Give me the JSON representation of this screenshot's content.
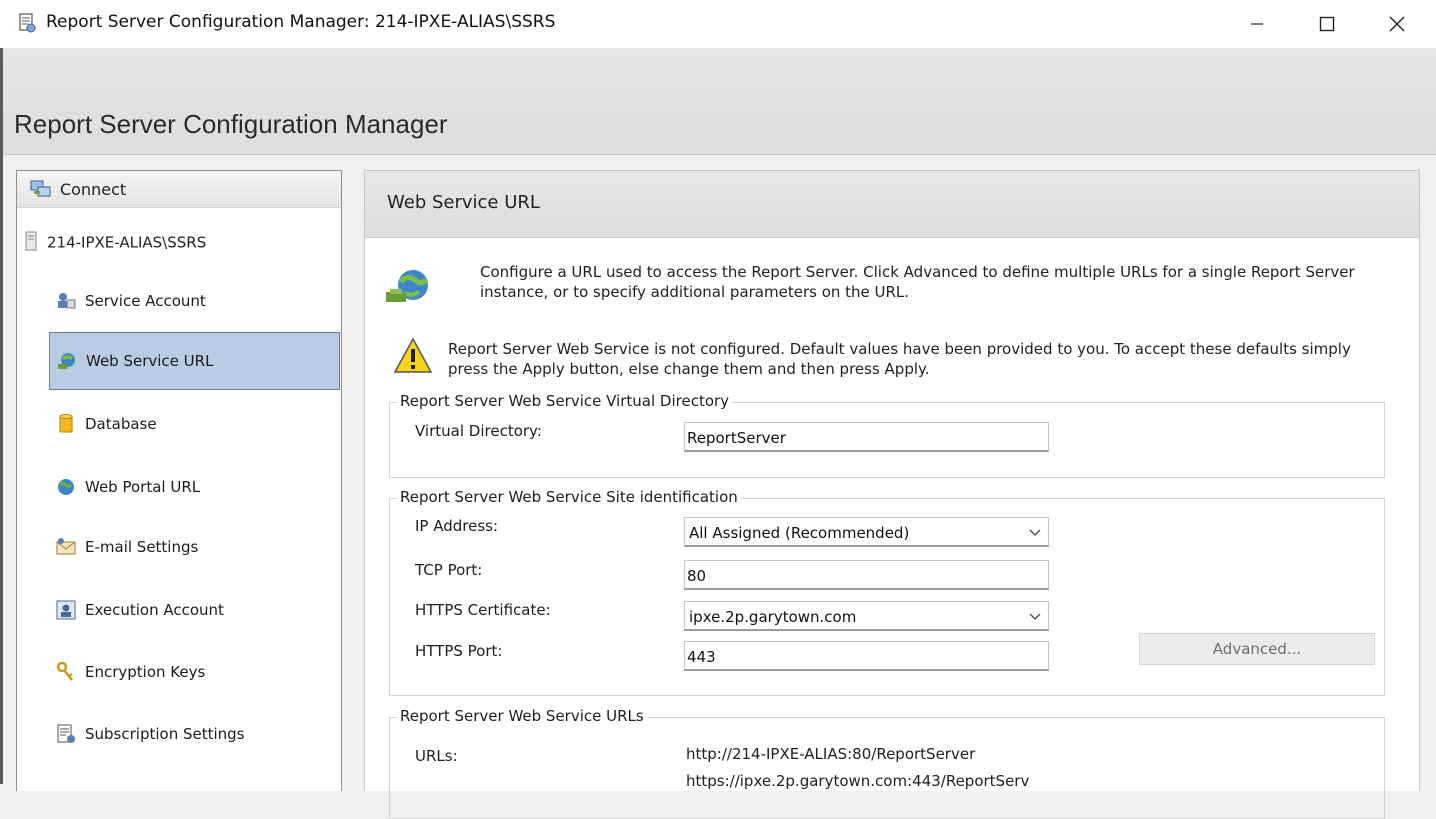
{
  "window": {
    "title": "Report Server Configuration Manager: 214-IPXE-ALIAS\\SSRS",
    "controls": [
      "minimize",
      "maximize",
      "close"
    ]
  },
  "header": {
    "title": "Report Server Configuration Manager"
  },
  "nav": {
    "connect_label": "Connect",
    "server_name": "214-IPXE-ALIAS\\SSRS",
    "items": [
      {
        "label": "Service Account",
        "icon": "service-account-icon"
      },
      {
        "label": "Web Service URL",
        "icon": "web-service-url-icon",
        "active": true
      },
      {
        "label": "Database",
        "icon": "database-icon"
      },
      {
        "label": "Web Portal URL",
        "icon": "globe-icon"
      },
      {
        "label": "E-mail Settings",
        "icon": "email-icon"
      },
      {
        "label": "Execution Account",
        "icon": "execution-account-icon"
      },
      {
        "label": "Encryption Keys",
        "icon": "keys-icon"
      },
      {
        "label": "Subscription Settings",
        "icon": "subscription-icon"
      }
    ]
  },
  "content": {
    "header_title": "Web Service URL",
    "description": "Configure a URL used to access the Report Server.  Click Advanced to define multiple URLs for a single Report Server instance, or to specify additional parameters on the URL.",
    "warning": "Report Server Web Service is not configured. Default values have been provided to you. To accept these defaults simply press the Apply button, else change them and then press Apply.",
    "vdir_group": {
      "title": "Report Server Web Service Virtual Directory",
      "label": "Virtual Directory:",
      "value": "ReportServer"
    },
    "site_group": {
      "title": "Report Server Web Service Site identification",
      "ip_label": "IP Address:",
      "ip_value": "All Assigned (Recommended)",
      "tcp_label": "TCP Port:",
      "tcp_value": "80",
      "cert_label": "HTTPS Certificate:",
      "cert_value": "ipxe.2p.garytown.com",
      "https_label": "HTTPS Port:",
      "https_value": "443",
      "advanced_label": "Advanced..."
    },
    "urls_group": {
      "title": "Report Server Web Service URLs",
      "label": "URLs:",
      "urls": [
        "http://214-IPXE-ALIAS:80/ReportServer",
        "https://ipxe.2p.garytown.com:443/ReportServ"
      ]
    }
  }
}
